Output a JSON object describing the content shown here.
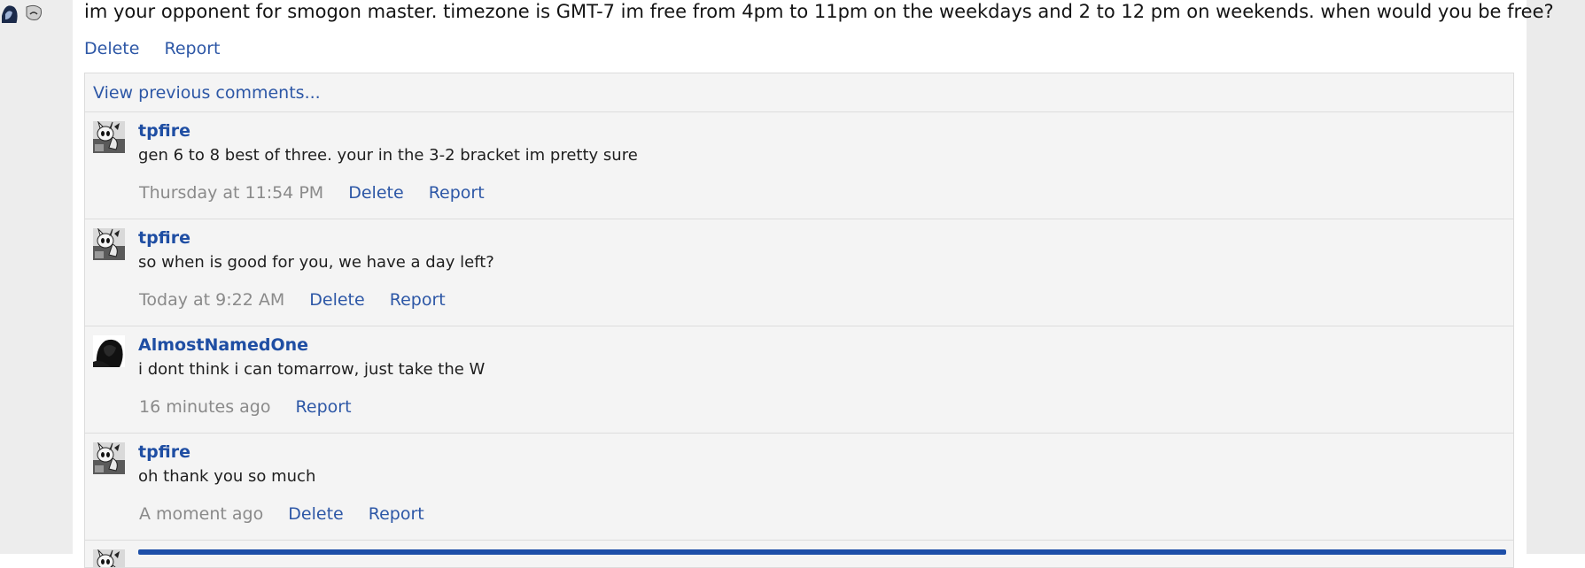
{
  "post": {
    "text": "im your opponent for smogon master. timezone is GMT-7 im free from 4pm to 11pm on the weekdays and 2 to 12 pm on weekends. when would you be free?",
    "delete_label": "Delete",
    "report_label": "Report"
  },
  "comments": {
    "view_previous_label": "View previous comments...",
    "items": [
      {
        "author": "tpfire",
        "text": "gen 6 to 8 best of three. your in the 3-2 bracket im pretty sure",
        "time": "Thursday at 11:54 PM",
        "delete_label": "Delete",
        "report_label": "Report"
      },
      {
        "author": "tpfire",
        "text": "so when is good for you, we have a day left?",
        "time": "Today at 9:22 AM",
        "delete_label": "Delete",
        "report_label": "Report"
      },
      {
        "author": "AlmostNamedOne",
        "text": "i dont think i can tomarrow, just take the W",
        "time": "16 minutes ago",
        "report_label": "Report"
      },
      {
        "author": "tpfire",
        "text": "oh thank you so much",
        "time": "A moment ago",
        "delete_label": "Delete",
        "report_label": "Report"
      }
    ]
  },
  "colors": {
    "link": "#2d57a6",
    "author": "#1f4ea3",
    "muted": "#8a8a8a",
    "reply_bar": "#1d4fa8",
    "comments_bg": "#f4f4f4"
  },
  "icons": {
    "tpfire_avatar": "tpfire-avatar-icon",
    "almostnamedone_avatar": "almostnamedone-avatar-icon"
  }
}
